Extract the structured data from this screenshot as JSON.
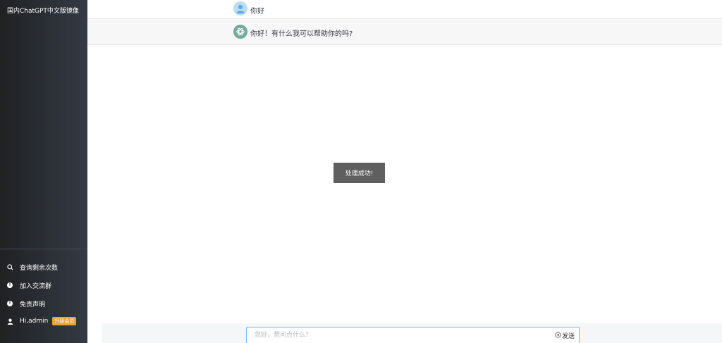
{
  "sidebar": {
    "brand": "国内ChatGPT中文版镜像",
    "items": [
      {
        "label": "查询剩余次数",
        "icon": "search-icon"
      },
      {
        "label": "加入交流群",
        "icon": "info-icon"
      },
      {
        "label": "免责声明",
        "icon": "info-icon"
      }
    ],
    "user": {
      "label": "Hi,admin",
      "icon": "user-icon",
      "badge": "升级会员"
    }
  },
  "chat": {
    "messages": [
      {
        "role": "user",
        "text": "你好",
        "avatar_icon": "user-avatar-icon"
      },
      {
        "role": "bot",
        "text": "你好！有什么我可以帮助你的吗?",
        "avatar_icon": "openai-logo-icon"
      }
    ]
  },
  "toast": {
    "text": "处理成功!"
  },
  "input": {
    "placeholder": "您好，想问点什么?",
    "value": "",
    "send_label": "发送",
    "send_icon": "send-icon"
  },
  "colors": {
    "sidebar_start": "#202123",
    "sidebar_end": "#343a45",
    "badge": "#e6a23c",
    "bot_row": "#f7f7f8",
    "input_border": "#7eb6e8",
    "toast_bg": "#5f5f5f"
  }
}
